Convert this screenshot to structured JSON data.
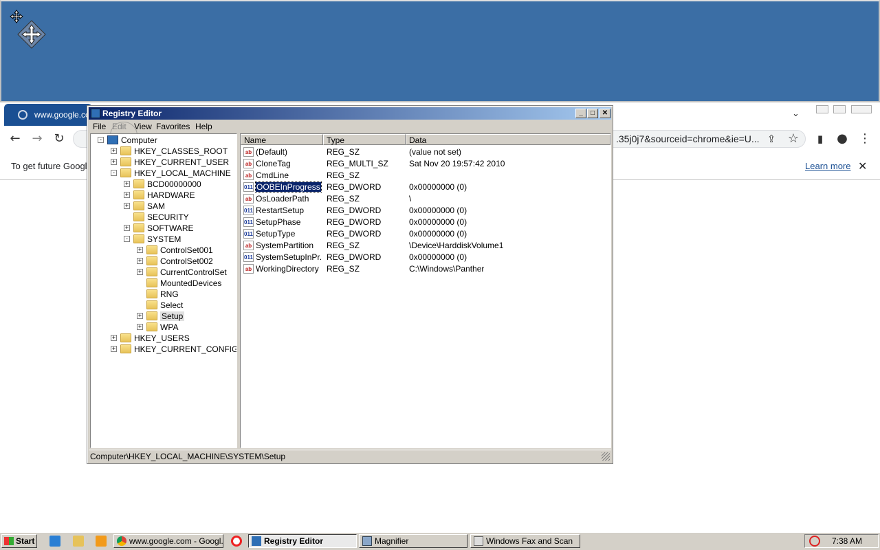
{
  "chrome": {
    "tab_title": "www.google.com",
    "url_visible": ".35j0j7&sourceid=chrome&ie=U...",
    "infobar_text": "To get future Google",
    "learn_more": "Learn more",
    "infobar_close": "✕"
  },
  "regedit": {
    "title": "Registry Editor",
    "caption": {
      "minimize": "_",
      "maximize": "□",
      "close": "✕"
    },
    "menu": [
      "File",
      "Edit",
      "View",
      "Favorites",
      "Help"
    ],
    "tree": [
      {
        "label": "Computer",
        "level": 0,
        "expander": "-"
      },
      {
        "label": "HKEY_CLASSES_ROOT",
        "level": 1,
        "expander": "+"
      },
      {
        "label": "HKEY_CURRENT_USER",
        "level": 1,
        "expander": "+"
      },
      {
        "label": "HKEY_LOCAL_MACHINE",
        "level": 1,
        "expander": "-"
      },
      {
        "label": "BCD00000000",
        "level": 2,
        "expander": "+"
      },
      {
        "label": "HARDWARE",
        "level": 2,
        "expander": "+"
      },
      {
        "label": "SAM",
        "level": 2,
        "expander": "+"
      },
      {
        "label": "SECURITY",
        "level": 2,
        "expander": ""
      },
      {
        "label": "SOFTWARE",
        "level": 2,
        "expander": "+"
      },
      {
        "label": "SYSTEM",
        "level": 2,
        "expander": "-"
      },
      {
        "label": "ControlSet001",
        "level": 3,
        "expander": "+"
      },
      {
        "label": "ControlSet002",
        "level": 3,
        "expander": "+"
      },
      {
        "label": "CurrentControlSet",
        "level": 3,
        "expander": "+"
      },
      {
        "label": "MountedDevices",
        "level": 3,
        "expander": ""
      },
      {
        "label": "RNG",
        "level": 3,
        "expander": ""
      },
      {
        "label": "Select",
        "level": 3,
        "expander": ""
      },
      {
        "label": "Setup",
        "level": 3,
        "expander": "+",
        "selected": true
      },
      {
        "label": "WPA",
        "level": 3,
        "expander": "+"
      },
      {
        "label": "HKEY_USERS",
        "level": 1,
        "expander": "+"
      },
      {
        "label": "HKEY_CURRENT_CONFIG",
        "level": 1,
        "expander": "+"
      }
    ],
    "columns": [
      "Name",
      "Type",
      "Data"
    ],
    "values": [
      {
        "icon": "ab",
        "name": "(Default)",
        "type": "REG_SZ",
        "data": "(value not set)"
      },
      {
        "icon": "ab",
        "name": "CloneTag",
        "type": "REG_MULTI_SZ",
        "data": "Sat Nov 20 19:57:42 2010"
      },
      {
        "icon": "ab",
        "name": "CmdLine",
        "type": "REG_SZ",
        "data": ""
      },
      {
        "icon": "dword",
        "name": "OOBEInProgress",
        "type": "REG_DWORD",
        "data": "0x00000000 (0)",
        "selected": true
      },
      {
        "icon": "ab",
        "name": "OsLoaderPath",
        "type": "REG_SZ",
        "data": "\\"
      },
      {
        "icon": "dword",
        "name": "RestartSetup",
        "type": "REG_DWORD",
        "data": "0x00000000 (0)"
      },
      {
        "icon": "dword",
        "name": "SetupPhase",
        "type": "REG_DWORD",
        "data": "0x00000000 (0)"
      },
      {
        "icon": "dword",
        "name": "SetupType",
        "type": "REG_DWORD",
        "data": "0x00000000 (0)"
      },
      {
        "icon": "ab",
        "name": "SystemPartition",
        "type": "REG_SZ",
        "data": "\\Device\\HarddiskVolume1"
      },
      {
        "icon": "dword",
        "name": "SystemSetupInPr...",
        "type": "REG_DWORD",
        "data": "0x00000000 (0)"
      },
      {
        "icon": "ab",
        "name": "WorkingDirectory",
        "type": "REG_SZ",
        "data": "C:\\Windows\\Panther"
      }
    ],
    "status": "Computer\\HKEY_LOCAL_MACHINE\\SYSTEM\\Setup"
  },
  "taskbar": {
    "start": "Start",
    "tasks": [
      {
        "label": "www.google.com - Googl...",
        "icon": "chrome-icon",
        "active": false
      },
      {
        "label": "Registry Editor",
        "icon": "regedit-icon",
        "active": true
      },
      {
        "label": "Magnifier",
        "icon": "magnifier-icon",
        "active": false
      },
      {
        "label": "Windows Fax and Scan",
        "icon": "fax-icon",
        "active": false
      }
    ],
    "clock": "7:38 AM"
  }
}
